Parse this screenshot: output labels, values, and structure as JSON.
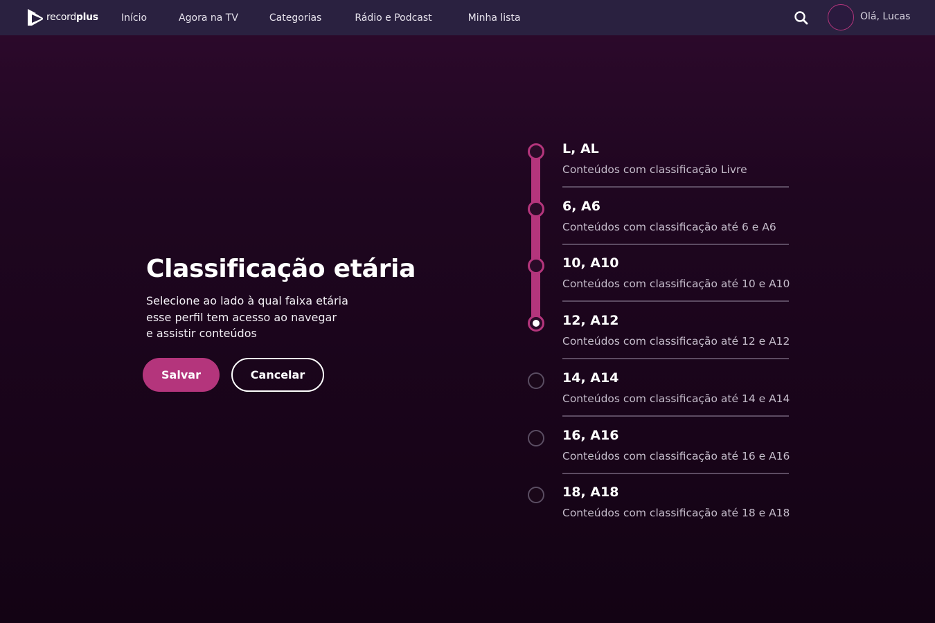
{
  "header": {
    "logo": {
      "text_light": "record",
      "text_bold": "plus"
    },
    "nav": [
      "Início",
      "Agora na TV",
      "Categorias",
      "Rádio e Podcast",
      "Minha lista"
    ],
    "search_icon": "search-icon",
    "greeting": "Olá, Lucas"
  },
  "main": {
    "title": "Classificação etária",
    "description_lines": [
      "Selecione ao lado à qual faixa etária",
      "esse perfil tem acesso ao navegar",
      "e assistir conteúdos"
    ],
    "save_label": "Salvar",
    "cancel_label": "Cancelar"
  },
  "ratings": [
    {
      "label": "L, AL",
      "desc": "Conteúdos com classificação Livre",
      "state": "on"
    },
    {
      "label": "6, A6",
      "desc": "Conteúdos com classificação até 6 e A6",
      "state": "on"
    },
    {
      "label": "10, A10",
      "desc": "Conteúdos com classificação até 10 e A10",
      "state": "on"
    },
    {
      "label": "12, A12",
      "desc": "Conteúdos com classificação até 12 e A12",
      "state": "selected"
    },
    {
      "label": "14, A14",
      "desc": "Conteúdos com classificação até 14 e A14",
      "state": "off"
    },
    {
      "label": "16, A16",
      "desc": "Conteúdos com classificação até 16 e A16",
      "state": "off"
    },
    {
      "label": "18, A18",
      "desc": "Conteúdos com classificação até 18 e A18",
      "state": "off"
    }
  ],
  "colors": {
    "accent": "#b4357c",
    "topbar": "#2a2140",
    "background_top": "#2e0a2d",
    "background_bottom": "#130314"
  }
}
